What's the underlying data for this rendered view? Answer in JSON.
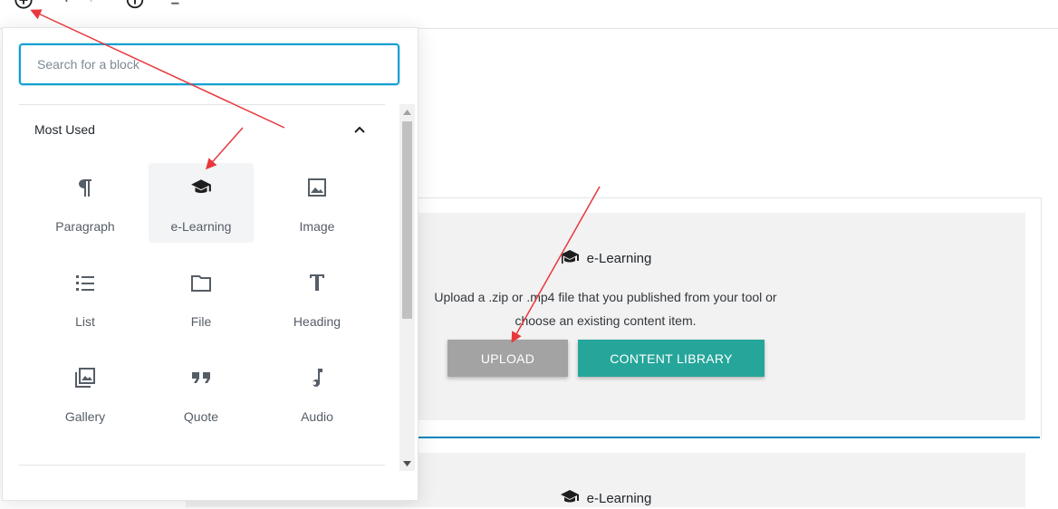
{
  "toolbar": {
    "icons": [
      "add-block-icon",
      "undo-icon",
      "redo-icon",
      "info-icon",
      "block-navigation-icon"
    ]
  },
  "inserter": {
    "search_placeholder": "Search for a block",
    "panel_title": "Most Used",
    "items": [
      {
        "label": "Paragraph",
        "icon": "paragraph-icon"
      },
      {
        "label": "e-Learning",
        "icon": "graduation-cap-icon"
      },
      {
        "label": "Image",
        "icon": "image-icon"
      },
      {
        "label": "List",
        "icon": "list-icon"
      },
      {
        "label": "File",
        "icon": "folder-icon"
      },
      {
        "label": "Heading",
        "icon": "heading-icon"
      },
      {
        "label": "Gallery",
        "icon": "gallery-icon"
      },
      {
        "label": "Quote",
        "icon": "quote-icon"
      },
      {
        "label": "Audio",
        "icon": "audio-icon"
      }
    ]
  },
  "block": {
    "title": "e-Learning",
    "description_line1": "Upload a .zip or .mp4 file that you published from your tool or",
    "description_line2": "choose an existing content item.",
    "upload_label": "UPLOAD",
    "library_label": "CONTENT LIBRARY"
  },
  "block2": {
    "title": "e-Learning"
  },
  "colors": {
    "accent": "#11a0d2",
    "library_button": "#26a69a",
    "upload_button": "#a3a3a3",
    "annotation_arrow": "#e8383d"
  }
}
